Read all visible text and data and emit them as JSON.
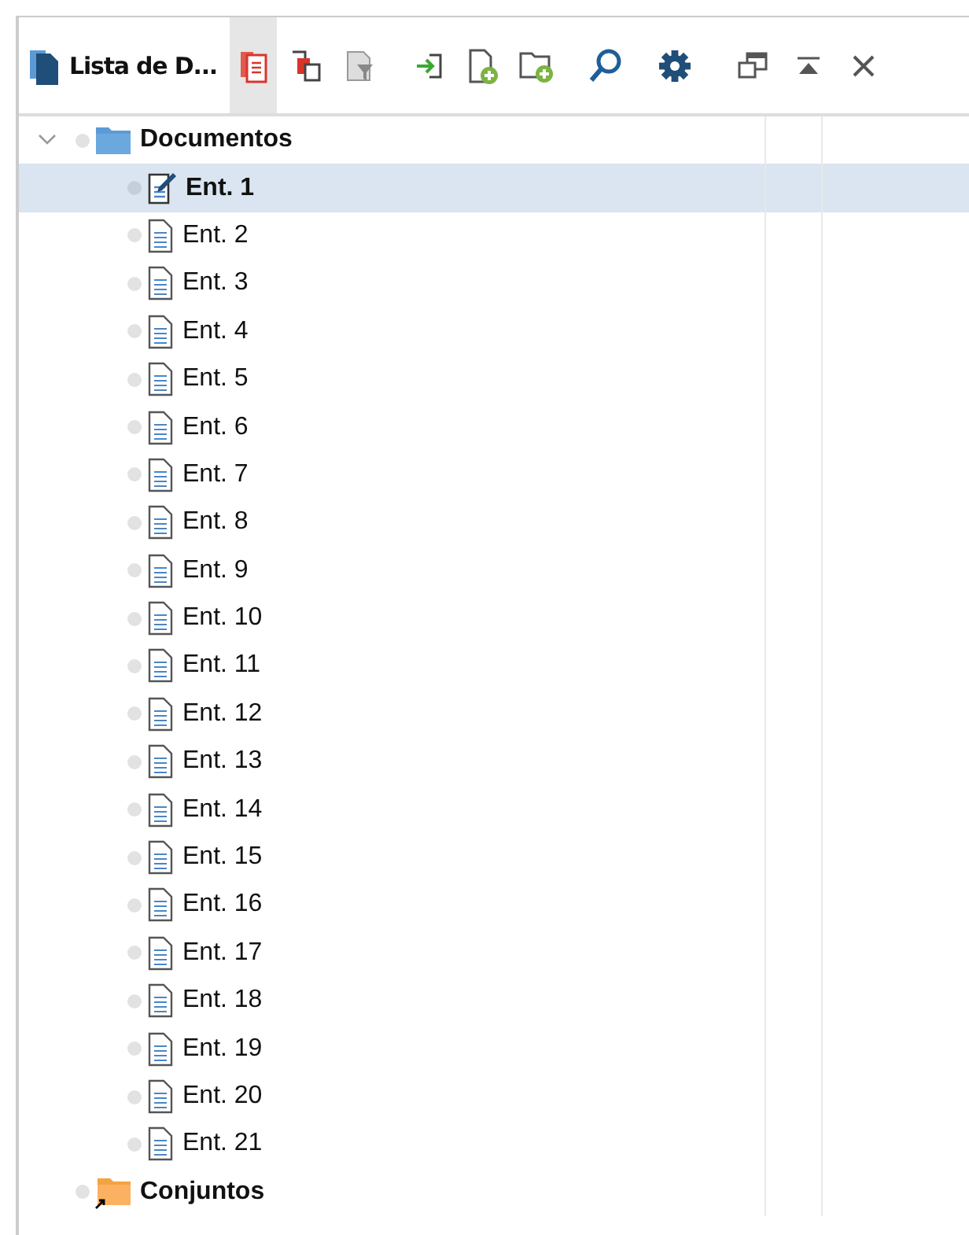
{
  "panel": {
    "title": "Lista de D..."
  },
  "toolbar": [
    {
      "kind": "paste",
      "pressed": true
    },
    {
      "kind": "copy",
      "pressed": false
    },
    {
      "kind": "filter",
      "pressed": false
    },
    {
      "kind": "import",
      "pressed": false
    },
    {
      "kind": "new-doc",
      "pressed": false
    },
    {
      "kind": "new-folder",
      "pressed": false
    },
    {
      "kind": "search",
      "pressed": false
    },
    {
      "kind": "settings",
      "pressed": false
    }
  ],
  "window_controls": [
    {
      "kind": "restore"
    },
    {
      "kind": "minimize"
    },
    {
      "kind": "close"
    }
  ],
  "tree": [
    {
      "label": "Documentos",
      "kind": "folder",
      "expanded": true,
      "children": [
        {
          "label": "Ent. 1",
          "kind": "edited",
          "selected": true
        },
        {
          "label": "Ent. 2",
          "kind": "document",
          "selected": false
        },
        {
          "label": "Ent. 3",
          "kind": "document",
          "selected": false
        },
        {
          "label": "Ent. 4",
          "kind": "document",
          "selected": false
        },
        {
          "label": "Ent. 5",
          "kind": "document",
          "selected": false
        },
        {
          "label": "Ent. 6",
          "kind": "document",
          "selected": false
        },
        {
          "label": "Ent. 7",
          "kind": "document",
          "selected": false
        },
        {
          "label": "Ent. 8",
          "kind": "document",
          "selected": false
        },
        {
          "label": "Ent. 9",
          "kind": "document",
          "selected": false
        },
        {
          "label": "Ent. 10",
          "kind": "document",
          "selected": false
        },
        {
          "label": "Ent. 11",
          "kind": "document",
          "selected": false
        },
        {
          "label": "Ent. 12",
          "kind": "document",
          "selected": false
        },
        {
          "label": "Ent. 13",
          "kind": "document",
          "selected": false
        },
        {
          "label": "Ent. 14",
          "kind": "document",
          "selected": false
        },
        {
          "label": "Ent. 15",
          "kind": "document",
          "selected": false
        },
        {
          "label": "Ent. 16",
          "kind": "document",
          "selected": false
        },
        {
          "label": "Ent. 17",
          "kind": "document",
          "selected": false
        },
        {
          "label": "Ent. 18",
          "kind": "document",
          "selected": false
        },
        {
          "label": "Ent. 19",
          "kind": "document",
          "selected": false
        },
        {
          "label": "Ent. 20",
          "kind": "document",
          "selected": false
        },
        {
          "label": "Ent. 21",
          "kind": "document",
          "selected": false
        }
      ]
    },
    {
      "label": "Conjuntos",
      "kind": "folder-link"
    }
  ]
}
